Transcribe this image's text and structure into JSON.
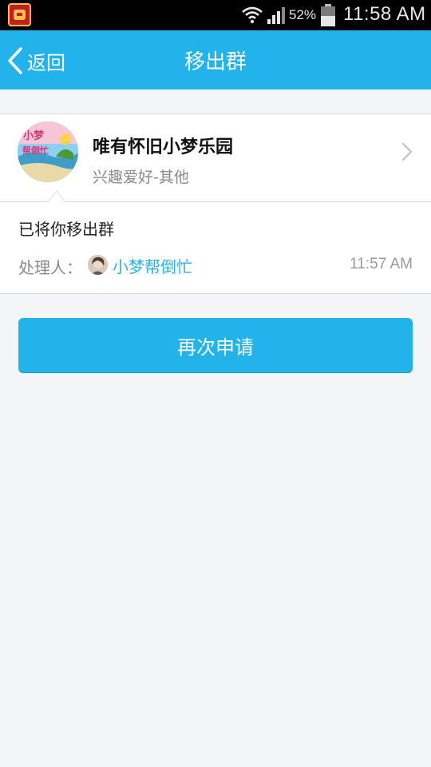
{
  "status_bar": {
    "battery_percent": "52%",
    "time": "11:58 AM"
  },
  "header": {
    "back_label": "返回",
    "title": "移出群"
  },
  "group": {
    "name": "唯有怀旧小梦乐园",
    "category": "兴趣爱好-其他",
    "avatar_text": [
      "小梦",
      "帮倒忙"
    ]
  },
  "message": {
    "text": "已将你移出群",
    "handler_label": "处理人：",
    "handler_name": "小梦帮倒忙",
    "time": "11:57 AM"
  },
  "actions": {
    "reapply_label": "再次申请"
  },
  "colors": {
    "accent": "#21b3ea",
    "background": "#f4f5f6"
  }
}
